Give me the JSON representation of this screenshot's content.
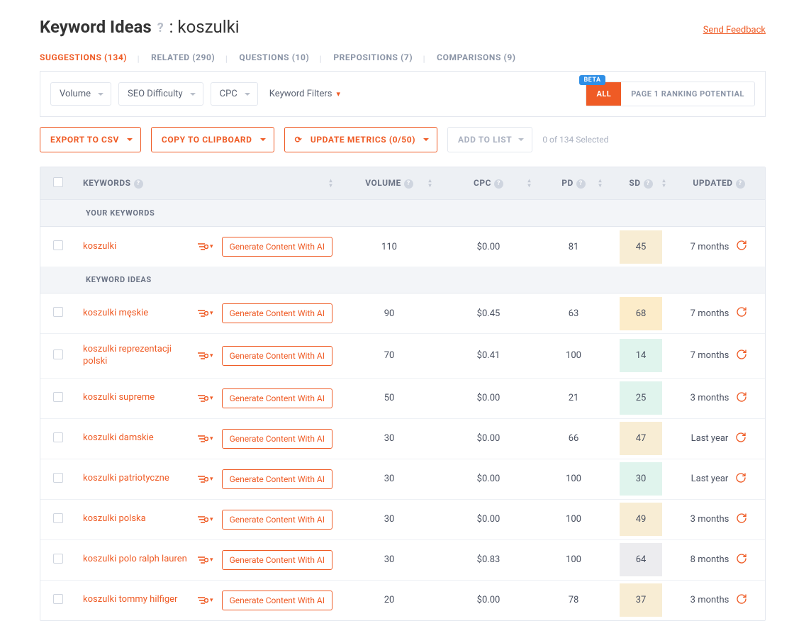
{
  "header": {
    "title_prefix": "Keyword Ideas",
    "keyword": "koszulki",
    "feedback_label": "Send Feedback"
  },
  "tabs": [
    {
      "label": "SUGGESTIONS",
      "count": 134,
      "active": true
    },
    {
      "label": "RELATED",
      "count": 290,
      "active": false
    },
    {
      "label": "QUESTIONS",
      "count": 10,
      "active": false
    },
    {
      "label": "PREPOSITIONS",
      "count": 7,
      "active": false
    },
    {
      "label": "COMPARISONS",
      "count": 9,
      "active": false
    }
  ],
  "filters": {
    "volume": "Volume",
    "seo_difficulty": "SEO Difficulty",
    "cpc": "CPC",
    "keyword_filters": "Keyword Filters"
  },
  "view_toggle": {
    "beta": "BETA",
    "all": "ALL",
    "potential": "PAGE 1 RANKING POTENTIAL"
  },
  "actions": {
    "export": "EXPORT TO CSV",
    "copy": "COPY TO CLIPBOARD",
    "update": "UPDATE METRICS",
    "update_count": "(0/50)",
    "add": "ADD TO LIST",
    "selected": "0 of 134 Selected"
  },
  "columns": {
    "keywords": "KEYWORDS",
    "volume": "VOLUME",
    "cpc": "CPC",
    "pd": "PD",
    "sd": "SD",
    "updated": "UPDATED"
  },
  "sections": {
    "yours": "YOUR KEYWORDS",
    "ideas": "KEYWORD IDEAS"
  },
  "gen_label": "Generate Content With AI",
  "your_keywords": [
    {
      "kw": "koszulki",
      "vol": "110",
      "cpc": "$0.00",
      "pd": "81",
      "sd": "45",
      "sd_color": "#f8edd4",
      "upd": "7 months"
    }
  ],
  "ideas": [
    {
      "kw": "koszulki męskie",
      "vol": "90",
      "cpc": "$0.45",
      "pd": "63",
      "sd": "68",
      "sd_color": "#fcecc9",
      "upd": "7 months"
    },
    {
      "kw": "koszulki reprezentacji polski",
      "vol": "70",
      "cpc": "$0.41",
      "pd": "100",
      "sd": "14",
      "sd_color": "#e0f4ed",
      "upd": "7 months"
    },
    {
      "kw": "koszulki supreme",
      "vol": "50",
      "cpc": "$0.00",
      "pd": "21",
      "sd": "25",
      "sd_color": "#e0f4ed",
      "upd": "3 months"
    },
    {
      "kw": "koszulki damskie",
      "vol": "30",
      "cpc": "$0.00",
      "pd": "66",
      "sd": "47",
      "sd_color": "#f8edd4",
      "upd": "Last year"
    },
    {
      "kw": "koszulki patriotyczne",
      "vol": "30",
      "cpc": "$0.00",
      "pd": "100",
      "sd": "30",
      "sd_color": "#e0f4ed",
      "upd": "Last year"
    },
    {
      "kw": "koszulki polska",
      "vol": "30",
      "cpc": "$0.00",
      "pd": "100",
      "sd": "49",
      "sd_color": "#f8edd4",
      "upd": "3 months"
    },
    {
      "kw": "koszulki polo ralph lauren",
      "vol": "30",
      "cpc": "$0.83",
      "pd": "100",
      "sd": "64",
      "sd_color": "#ececef",
      "upd": "8 months"
    },
    {
      "kw": "koszulki tommy hilfiger",
      "vol": "20",
      "cpc": "$0.00",
      "pd": "78",
      "sd": "37",
      "sd_color": "#f8edd4",
      "upd": "3 months"
    }
  ]
}
